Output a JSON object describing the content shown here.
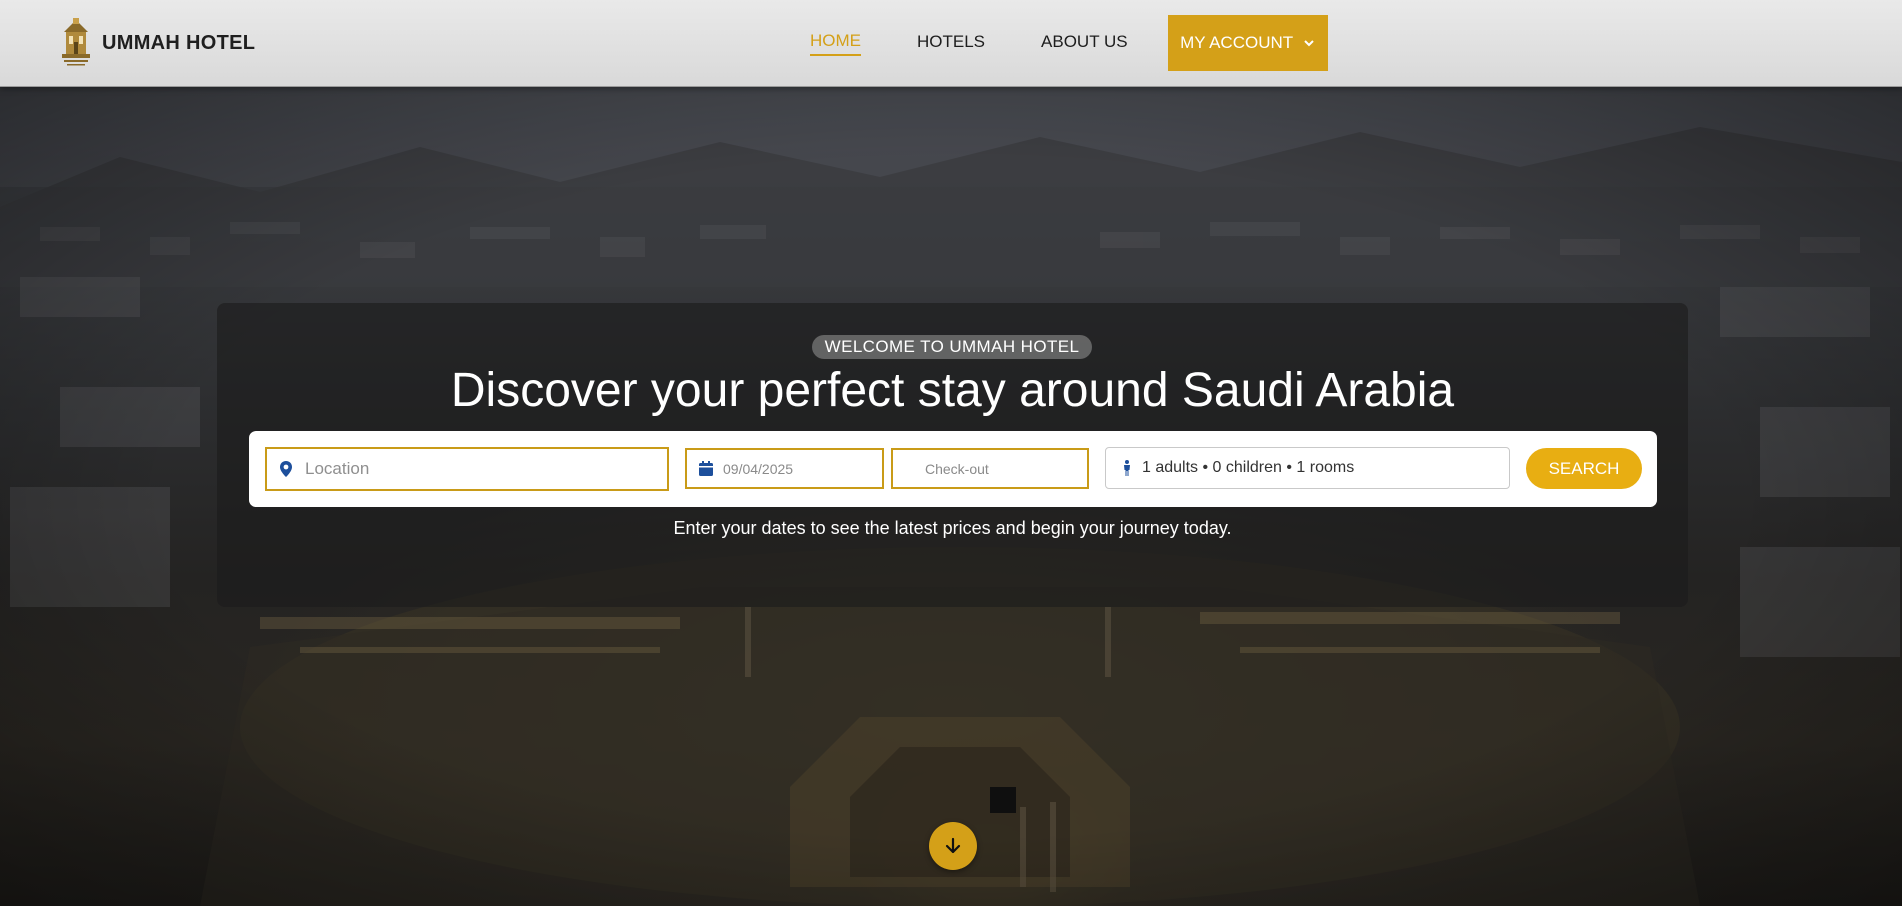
{
  "brand": {
    "name": "UMMAH HOTEL",
    "logo_icon": "hotel-crest-logo"
  },
  "nav": {
    "items": [
      {
        "label": "HOME",
        "active": true
      },
      {
        "label": "HOTELS",
        "active": false
      },
      {
        "label": "ABOUT US",
        "active": false
      }
    ],
    "account_label": "MY ACCOUNT",
    "account_icon": "chevron-down-icon"
  },
  "hero": {
    "badge": "WELCOME TO UMMAH HOTEL",
    "title": "Discover your perfect stay around Saudi Arabia",
    "tagline": "Enter your dates to see the latest prices and begin your journey today."
  },
  "search": {
    "location_placeholder": "Location",
    "location_icon": "map-pin-icon",
    "checkin_value": "09/04/2025",
    "checkin_icon": "calendar-icon",
    "checkout_placeholder": "Check-out",
    "guests_value": "1 adults • 0 children • 1 rooms",
    "guests_icon": "person-icon",
    "search_label": "SEARCH"
  },
  "scroll": {
    "icon": "arrow-down-icon"
  },
  "colors": {
    "accent": "#d4a018",
    "search_button": "#e8ae12",
    "pin_blue": "#1d4f9c"
  }
}
